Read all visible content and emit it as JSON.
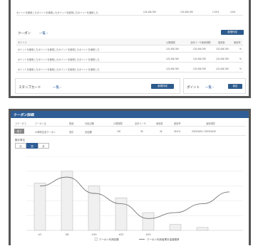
{
  "top_panel": {
    "summary_row": [
      "ポイントを使用したポイントを使用したポイントを使用したポイントを使用した",
      "123,456,789",
      "123,456,789",
      "1.23%",
      "4.5%"
    ],
    "coupon_title": "クーポン",
    "coupon_link": "一覧 ›",
    "coupon_add": "新規作成",
    "coupon_headers": [
      "タイトル",
      "",
      "公開期限",
      "全体ユーザ使用期限",
      "使用数",
      "使用率"
    ],
    "coupon_rows": [
      [
        "ポイントを使用したポイントを使用したポイントを使用したポイントを使用した",
        "123,456,789",
        "123,456,789",
        "123,456,789",
        "%"
      ],
      [
        "ポイントを使用したポイントを使用したポイントを使用したポイントを使用した",
        "123,456,789",
        "123,456,789",
        "123,456,789",
        "%"
      ],
      [
        "ポイントを使用したポイントを使用したポイントを使用したポイントを使用した",
        "123,456,789",
        "123,456,789",
        "123,456,789",
        "%"
      ]
    ],
    "stamp_title": "スタンプカード",
    "stamp_link": "一覧 ›",
    "stamp_btn": "新規作成",
    "point_title": "ポイント",
    "point_link": "一覧 ›",
    "point_btn": "設定"
  },
  "bottom_panel": {
    "title": "クーポン詳細",
    "headers": [
      "ステータス",
      "クーポン名",
      "数値",
      "対象店舗",
      "公開期限",
      "全体ユーザ",
      "使用数",
      "使用率",
      "適用期間"
    ],
    "row": [
      "終了",
      "10周年記念クーポン",
      "割引",
      "全店舗",
      "100",
      "35",
      "35",
      "35.0%",
      "2023/04/01~2023/04/30"
    ],
    "period_label": "集計単位",
    "tabs": [
      "日",
      "週",
      "月"
    ],
    "active_tab": 1,
    "legend_bar": "クーポン利用回数",
    "legend_line": "クーポン利用者累計金額推移"
  },
  "chart_data": {
    "type": "bar",
    "categories": [
      "4/1",
      "4/8",
      "4/15",
      "4/22",
      "4/29",
      "",
      "",
      ""
    ],
    "series": [
      {
        "name": "クーポン利用回数",
        "type": "bar",
        "values": [
          32,
          40,
          30,
          22,
          12,
          4,
          2,
          0
        ]
      },
      {
        "name": "クーポン利用者累計金額推移",
        "type": "line",
        "values": [
          30,
          36,
          25,
          18,
          8,
          12,
          18,
          26
        ]
      }
    ],
    "ylim": [
      0,
      50
    ],
    "grid": true,
    "legend": "bottom"
  }
}
